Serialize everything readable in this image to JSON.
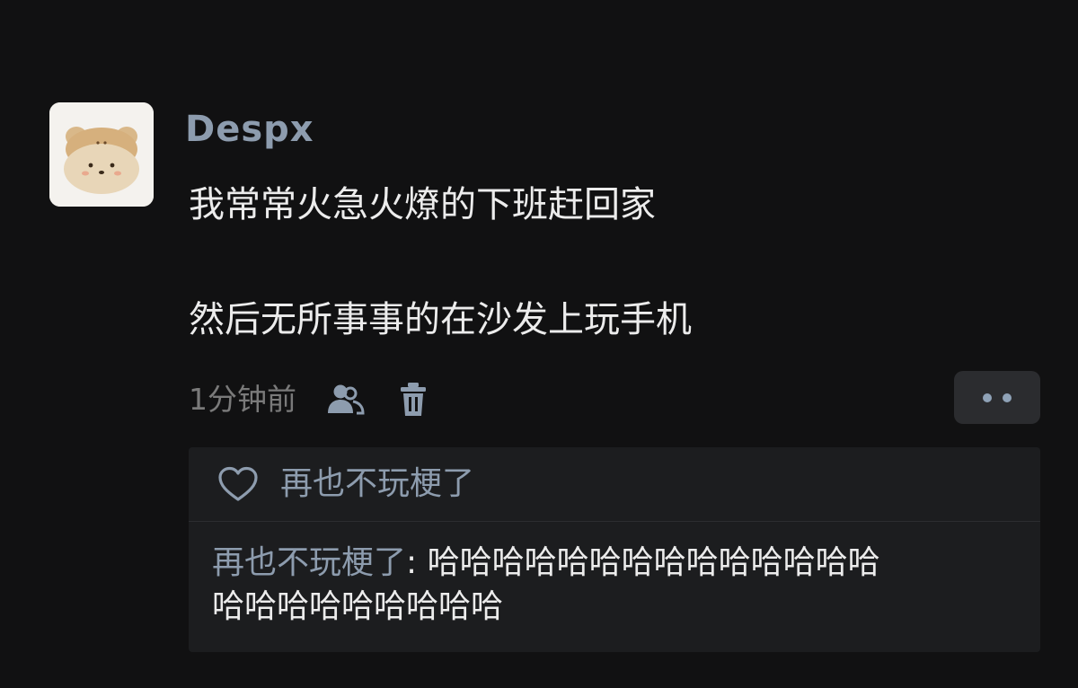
{
  "post": {
    "username": "Despx",
    "avatar_icon": "bear-bun-avatar",
    "content_lines": [
      "我常常火急火燎的下班赶回家",
      "然后无所事事的在沙发上玩手机"
    ],
    "timestamp": "1分钟前",
    "visibility_icon": "friends-icon",
    "delete_icon": "trash-icon",
    "more_icon": "more-dots-icon"
  },
  "likes": {
    "icon": "heart-icon",
    "names": "再也不玩梗了"
  },
  "comments": [
    {
      "author": "再也不玩梗了",
      "separator": ": ",
      "text_line1": "哈哈哈哈哈哈哈哈哈哈哈哈哈哈",
      "text_line2": "哈哈哈哈哈哈哈哈哈"
    }
  ],
  "colors": {
    "background": "#111112",
    "name_blue": "#8d9cae",
    "text": "#ececec",
    "muted": "#7a7a7a",
    "panel": "#1c1d1f"
  }
}
